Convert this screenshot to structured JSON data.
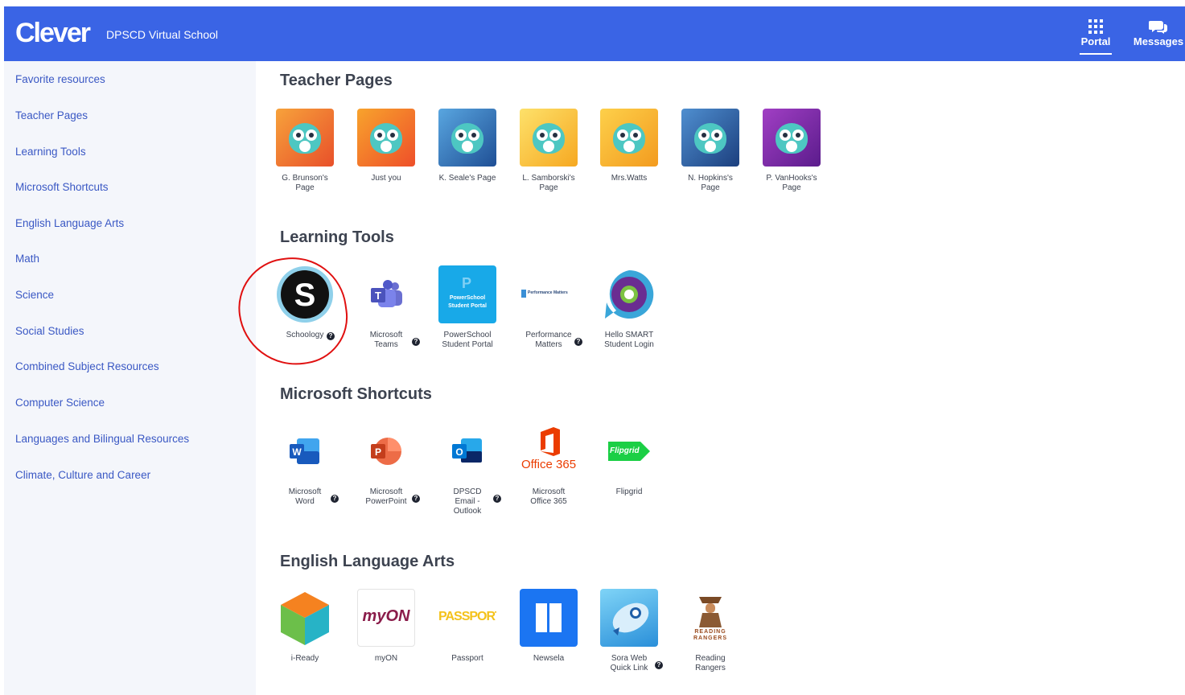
{
  "header": {
    "logo": "Clever",
    "district": "DPSCD Virtual School",
    "nav": [
      {
        "label": "Portal",
        "icon": "grid-icon"
      },
      {
        "label": "Messages",
        "icon": "chat-icon"
      }
    ]
  },
  "sidebar": {
    "items": [
      {
        "label": "Favorite resources"
      },
      {
        "label": "Teacher Pages"
      },
      {
        "label": "Learning Tools"
      },
      {
        "label": "Microsoft Shortcuts"
      },
      {
        "label": "English Language Arts"
      },
      {
        "label": "Math"
      },
      {
        "label": "Science"
      },
      {
        "label": "Social Studies"
      },
      {
        "label": "Combined Subject Resources"
      },
      {
        "label": "Computer Science"
      },
      {
        "label": "Languages and Bilingual Resources"
      },
      {
        "label": "Climate, Culture and Career"
      }
    ]
  },
  "sections": [
    {
      "title": "Teacher Pages",
      "apps": [
        {
          "label": "G. Brunson's Page",
          "icon": "owl-icon",
          "bg": "#f06a2a"
        },
        {
          "label": "Just you",
          "icon": "owl-icon",
          "bg": "#f36c24"
        },
        {
          "label": "K. Seale's Page",
          "icon": "owl-icon",
          "bg": "#2f6fb5"
        },
        {
          "label": "L. Samborski's Page",
          "icon": "owl-icon",
          "bg": "#f7c531"
        },
        {
          "label": "Mrs.Watts",
          "icon": "owl-icon",
          "bg": "#f9b823"
        },
        {
          "label": "N. Hopkins's Page",
          "icon": "owl-icon",
          "bg": "#2b5fa5"
        },
        {
          "label": "P. VanHooks's Page",
          "icon": "owl-icon",
          "bg": "#7a2aa8"
        }
      ]
    },
    {
      "title": "Learning Tools",
      "apps": [
        {
          "label": "Schoology",
          "icon": "schoology-icon",
          "help": true
        },
        {
          "label": "Microsoft Teams",
          "icon": "teams-icon",
          "help": true
        },
        {
          "label": "PowerSchool Student Portal",
          "icon": "powerschool-icon",
          "tile_text": "PowerSchool Student Portal"
        },
        {
          "label": "Performance Matters",
          "icon": "performance-matters-icon",
          "help": true,
          "tile_text": "Performance Matters"
        },
        {
          "label": "Hello SMART Student Login",
          "icon": "hello-smart-icon"
        }
      ]
    },
    {
      "title": "Microsoft Shortcuts",
      "apps": [
        {
          "label": "Microsoft Word",
          "icon": "word-icon",
          "help": true,
          "tile_text": "W"
        },
        {
          "label": "Microsoft PowerPoint",
          "icon": "powerpoint-icon",
          "help": true,
          "tile_text": "P"
        },
        {
          "label": "DPSCD Email - Outlook",
          "icon": "outlook-icon",
          "help": true,
          "tile_text": "O"
        },
        {
          "label": "Microsoft Office 365",
          "icon": "office365-icon",
          "tile_text": "Office 365"
        },
        {
          "label": "Flipgrid",
          "icon": "flipgrid-icon",
          "tile_text": "Flipgrid"
        }
      ]
    },
    {
      "title": "English Language Arts",
      "apps": [
        {
          "label": "i-Ready",
          "icon": "iready-cube-icon"
        },
        {
          "label": "myON",
          "icon": "myon-icon",
          "tile_text": "myON"
        },
        {
          "label": "Passport",
          "icon": "passport-icon",
          "tile_text": "PASSPORT"
        },
        {
          "label": "Newsela",
          "icon": "newsela-icon"
        },
        {
          "label": "Sora Web Quick Link",
          "icon": "sora-icon",
          "help": true
        },
        {
          "label": "Reading Rangers",
          "icon": "reading-rangers-icon",
          "tile_text": "READING RANGERS"
        }
      ]
    }
  ]
}
